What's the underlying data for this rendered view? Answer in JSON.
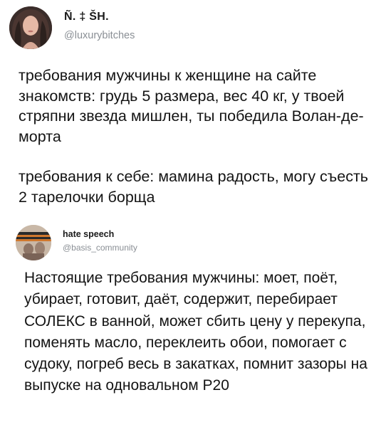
{
  "tweet1": {
    "author_name": "Ñ. ‡ ŠH.",
    "author_handle": "@luxurybitches",
    "avatar": "profile-photo-woman",
    "paragraphs": [
      "требования мужчины к женщине на сайте знакомств: грудь 5 размера, вес 40 кг, у твоей стряпни звезда мишлен, ты победила Волан-де-морта",
      "требования к себе: мамина радость, могу съесть 2 тарелочки борща"
    ]
  },
  "tweet2": {
    "author_name": "hate speech",
    "author_handle": "@basis_community",
    "avatar": "profile-photo-vintage",
    "paragraphs": [
      "Настоящие требования мужчины: моет, поёт, убирает, готовит, даёт, содержит, перебирает СОЛЕКС в ванной, может сбить цену у перекупа, поменять масло, переклеить обои, помогает с судоку, погреб весь в закатках, помнит зазоры на выпуске на одновальном Р20"
    ]
  }
}
